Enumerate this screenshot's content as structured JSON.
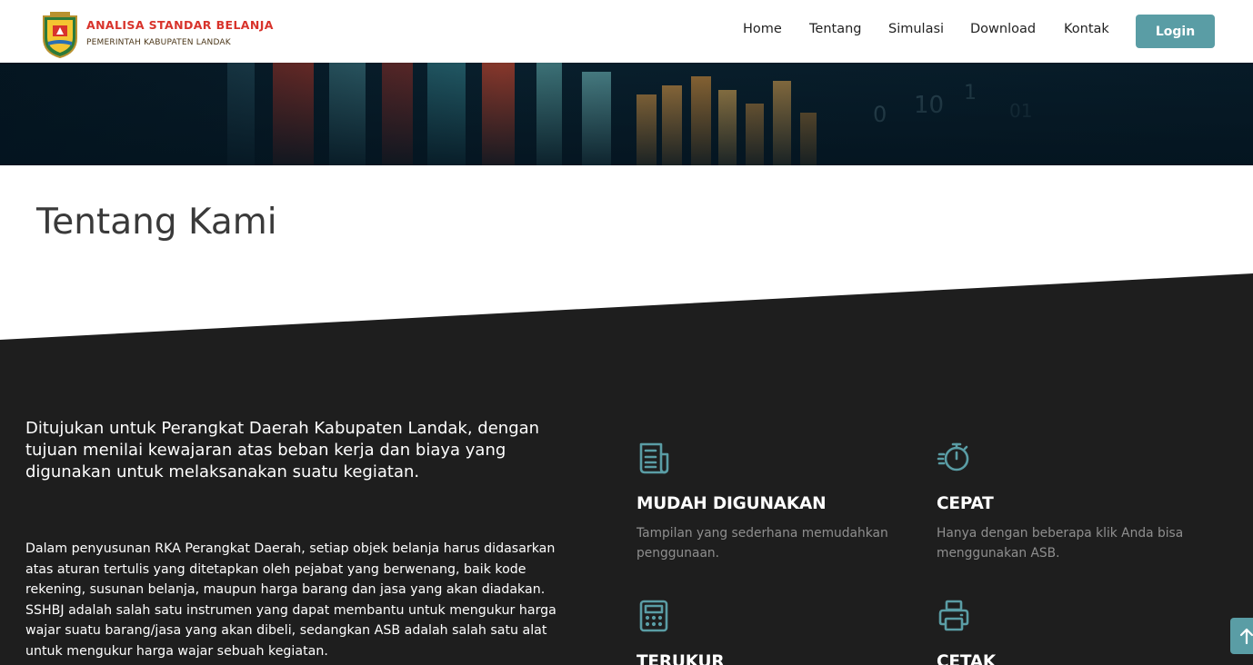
{
  "brand": {
    "title": "ANALISA STANDAR BELANJA",
    "subtitle": "PEMERINTAH KABUPATEN LANDAK",
    "emblem_icon": "landak-regency-emblem"
  },
  "nav": {
    "items": [
      "Home",
      "Tentang",
      "Simulasi",
      "Download",
      "Kontak"
    ],
    "login_label": "Login"
  },
  "page": {
    "title": "Tentang Kami"
  },
  "about": {
    "lead": "Ditujukan untuk Perangkat Daerah Kabupaten Landak, dengan tujuan menilai kewajaran atas beban kerja dan biaya yang digunakan untuk melaksanakan suatu kegiatan.",
    "body": "Dalam penyusunan RKA Perangkat Daerah, setiap objek belanja harus didasarkan atas aturan tertulis yang ditetapkan oleh pejabat yang berwenang, baik kode rekening, susunan belanja, maupun harga barang dan jasa yang akan diadakan. SSHBJ adalah salah satu instrumen yang dapat membantu untuk mengukur harga wajar suatu barang/jasa yang akan dibeli, sedangkan ASB adalah salah satu alat untuk mengukur harga wajar sebuah kegiatan."
  },
  "features": [
    {
      "icon": "document-icon",
      "title": "MUDAH DIGUNAKAN",
      "desc": "Tampilan yang sederhana memudahkan penggunaan."
    },
    {
      "icon": "stopwatch-icon",
      "title": "CEPAT",
      "desc": "Hanya dengan beberapa klik Anda bisa menggunakan ASB."
    },
    {
      "icon": "calculator-icon",
      "title": "TERUKUR",
      "desc": ""
    },
    {
      "icon": "printer-icon",
      "title": "CETAK",
      "desc": ""
    }
  ],
  "colors": {
    "accent": "#5a9da5",
    "brand_red": "#d8332b",
    "dark_section": "#1e1e1e",
    "muted_text": "#8f8f8f"
  },
  "scroll_top_icon": "arrow-up-icon"
}
